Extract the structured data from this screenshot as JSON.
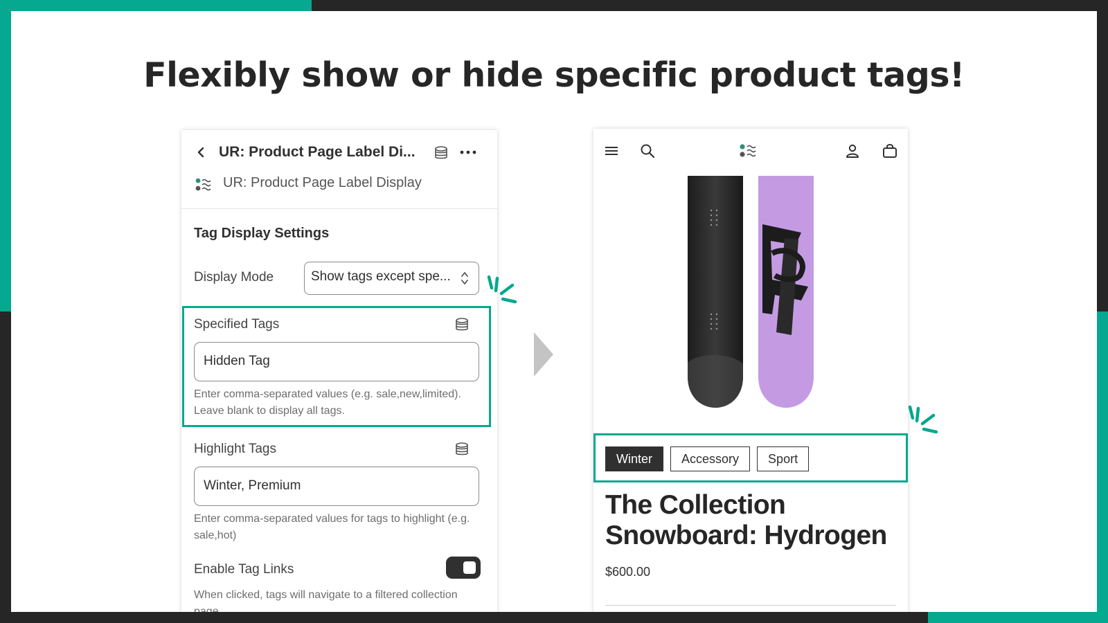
{
  "headline": "Flexibly show or hide specific product tags!",
  "colors": {
    "accent": "#06a88f",
    "dark": "#262626"
  },
  "editor": {
    "title": "UR: Product Page Label Di...",
    "app_name": "UR: Product Page Label Display",
    "section_title": "Tag Display Settings",
    "display_mode": {
      "label": "Display Mode",
      "value": "Show tags except spe..."
    },
    "specified_tags": {
      "label": "Specified Tags",
      "value": "Hidden Tag",
      "help": "Enter comma-separated values (e.g. sale,new,limited). Leave blank to display all tags."
    },
    "highlight_tags": {
      "label": "Highlight Tags",
      "value": "Winter, Premium",
      "help": "Enter comma-separated values for tags to highlight (e.g. sale,hot)"
    },
    "tag_links": {
      "label": "Enable Tag Links",
      "enabled": true,
      "help": "When clicked, tags will navigate to a filtered collection page"
    },
    "icons": [
      "back-icon",
      "database-icon",
      "more-icon",
      "app-logo-icon",
      "select-arrows-icon"
    ]
  },
  "storefront": {
    "icons": [
      "menu-icon",
      "search-icon",
      "store-logo-icon",
      "account-icon",
      "cart-icon"
    ],
    "tags": [
      {
        "label": "Winter",
        "highlighted": true
      },
      {
        "label": "Accessory",
        "highlighted": false
      },
      {
        "label": "Sport",
        "highlighted": false
      }
    ],
    "product_title": "The Collection Snowboard: Hydrogen",
    "price": "$600.00"
  }
}
